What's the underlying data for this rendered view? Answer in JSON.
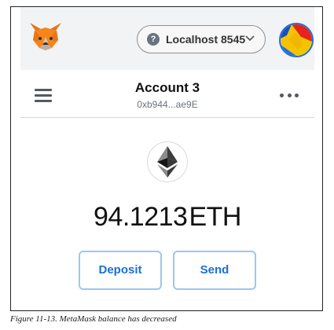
{
  "header": {
    "network": {
      "label": "Localhost 8545",
      "help_icon": "question-circle-icon",
      "chevron_icon": "chevron-down-icon"
    },
    "logo_icon": "metamask-fox-icon",
    "avatar_icon": "account-identicon"
  },
  "account": {
    "name": "Account 3",
    "address": "0xb944...ae9E",
    "menu_icon": "hamburger-menu-icon",
    "options_icon": "kebab-menu-icon"
  },
  "balance": {
    "asset_icon": "ethereum-icon",
    "amount": "94.1213",
    "unit": "ETH"
  },
  "actions": {
    "deposit_label": "Deposit",
    "send_label": "Send"
  },
  "caption": "Figure 11-13. MetaMask balance has decreased",
  "colors": {
    "accent": "#1b6fd6",
    "button_border": "#9cc7f0",
    "header_bg": "#f2f3f4"
  }
}
